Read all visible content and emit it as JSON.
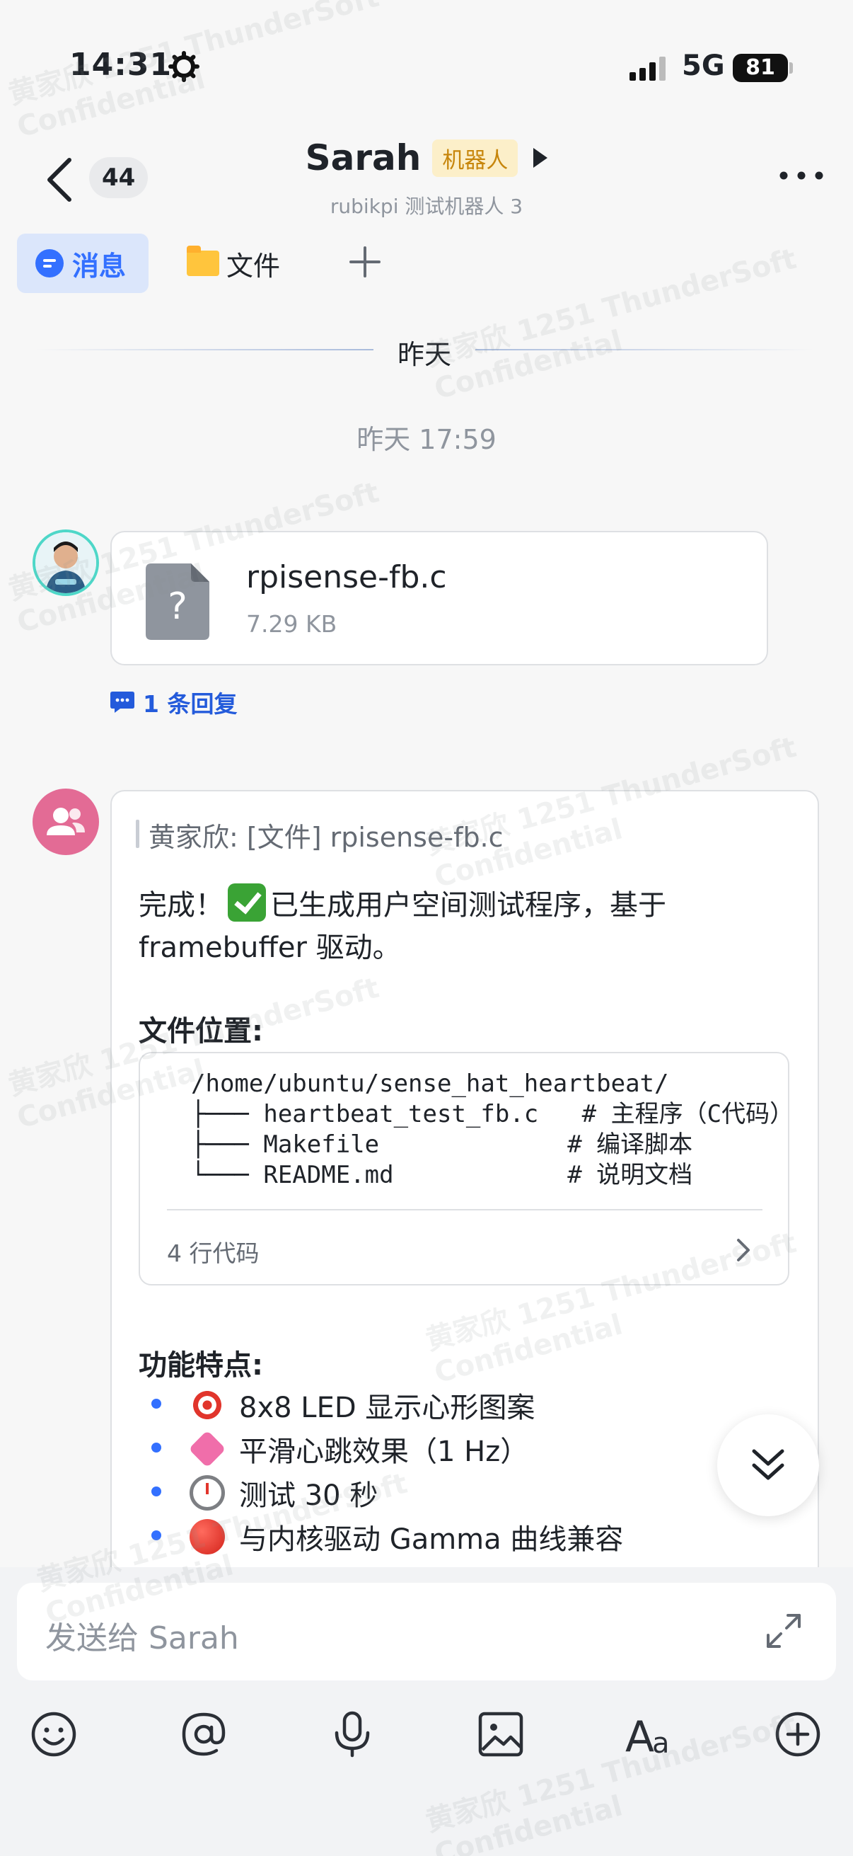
{
  "status_bar": {
    "time": "14:31",
    "network": "5G",
    "battery": "81"
  },
  "header": {
    "back_badge": "44",
    "title": "Sarah",
    "bot_tag": "机器人",
    "subtitle": "rubikpi 测试机器人 3"
  },
  "tabs": [
    {
      "label": "消息",
      "icon": "message-icon",
      "active": true
    },
    {
      "label": "文件",
      "icon": "folder-icon",
      "active": false
    }
  ],
  "date_divider": "昨天",
  "time_label": "昨天 17:59",
  "file_message": {
    "file_name": "rpisense-fb.c",
    "file_size": "7.29 KB",
    "reply_count": "1 条回复"
  },
  "bot_message": {
    "quote": "黄家欣: [文件] rpisense-fb.c",
    "intro_part1": "完成！",
    "intro_part2": "已生成用户空间测试程序，基于",
    "intro_line2": "framebuffer 驱动。",
    "location_heading": "文件位置:",
    "code": "/home/ubuntu/sense_hat_heartbeat/\n├─── heartbeat_test_fb.c   # 主程序（C代码）\n├─── Makefile             # 编译脚本\n└─── README.md            # 说明文档",
    "code_line_count": "4 行代码",
    "features_heading": "功能特点:",
    "features": [
      {
        "emoji": "dart-icon",
        "text": "8x8 LED 显示心形图案"
      },
      {
        "emoji": "heart-icon",
        "text": "平滑心跳效果（1 Hz）"
      },
      {
        "emoji": "timer-icon",
        "text": "测试 30 秒"
      },
      {
        "emoji": "red-circle-icon",
        "text": "与内核驱动 Gamma 曲线兼容"
      }
    ]
  },
  "input": {
    "placeholder": "发送给 Sarah"
  },
  "toolbar": [
    "emoji-icon",
    "mention-icon",
    "mic-icon",
    "image-icon",
    "text-format-icon",
    "add-icon"
  ],
  "watermark": {
    "line1": "黄家欣 1251 ThunderSoft",
    "line2": "Confidential"
  },
  "colors": {
    "accent": "#3370ff",
    "bot_tag_bg": "#fcefc9",
    "bot_tag_text": "#c7860c",
    "avatar_group": "#e36b95"
  }
}
